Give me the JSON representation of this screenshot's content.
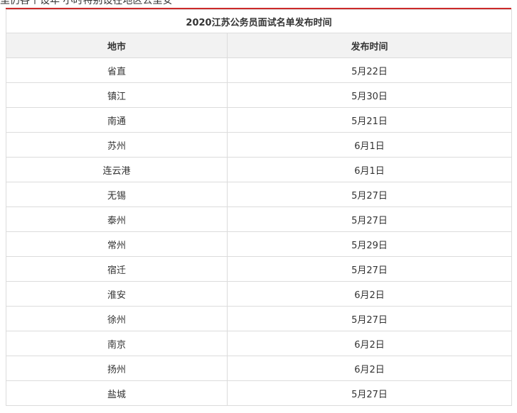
{
  "top_text": "里仍各个设年 小时特别设在地区公里安",
  "table": {
    "caption": "2020江苏公务员面试名单发布时间",
    "headers": [
      "地市",
      "发布时间"
    ],
    "rows": [
      {
        "city": "省直",
        "date": "5月22日"
      },
      {
        "city": "镇江",
        "date": "5月30日"
      },
      {
        "city": "南通",
        "date": "5月21日"
      },
      {
        "city": "苏州",
        "date": "6月1日"
      },
      {
        "city": "连云港",
        "date": "6月1日"
      },
      {
        "city": "无锡",
        "date": "5月27日"
      },
      {
        "city": "泰州",
        "date": "5月27日"
      },
      {
        "city": "常州",
        "date": "5月29日"
      },
      {
        "city": "宿迁",
        "date": "5月27日"
      },
      {
        "city": "淮安",
        "date": "6月2日"
      },
      {
        "city": "徐州",
        "date": "5月27日"
      },
      {
        "city": "南京",
        "date": "6月2日"
      },
      {
        "city": "扬州",
        "date": "6月2日"
      },
      {
        "city": "盐城",
        "date": "5月27日"
      }
    ]
  },
  "colors": {
    "accent_line": "#cc2a2a",
    "header_bg": "#f2f2f2",
    "border": "#dcdcdc"
  }
}
